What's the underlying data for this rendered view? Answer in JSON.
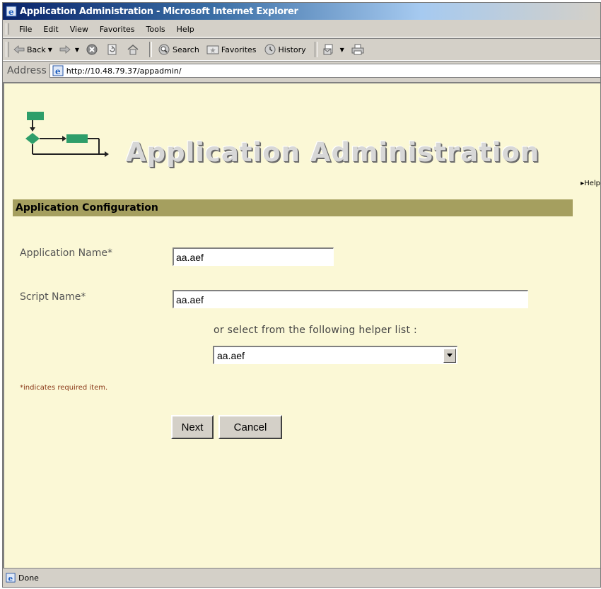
{
  "window": {
    "title": "Application Administration - Microsoft Internet Explorer"
  },
  "menu": [
    "File",
    "Edit",
    "View",
    "Favorites",
    "Tools",
    "Help"
  ],
  "toolbar": {
    "back_label": "Back",
    "search_label": "Search",
    "favorites_label": "Favorites",
    "history_label": "History"
  },
  "address": {
    "label": "Address",
    "url": "http://10.48.79.37/appadmin/"
  },
  "page": {
    "banner_title": "Application Administration",
    "help_link": "Help",
    "section_title": "Application Configuration",
    "app_name_label": "Application Name*",
    "app_name_value": "aa.aef",
    "script_name_label": "Script Name*",
    "script_name_value": "aa.aef",
    "helper_text": "or select from the following helper list :",
    "helper_selected": "aa.aef",
    "required_note": "*indicates required item.",
    "next_button": "Next",
    "cancel_button": "Cancel"
  },
  "status": {
    "text": "Done"
  },
  "colors": {
    "page_background": "#fbf8d6",
    "section_header": "#a59f5f",
    "logo_green": "#2e9e6a"
  }
}
